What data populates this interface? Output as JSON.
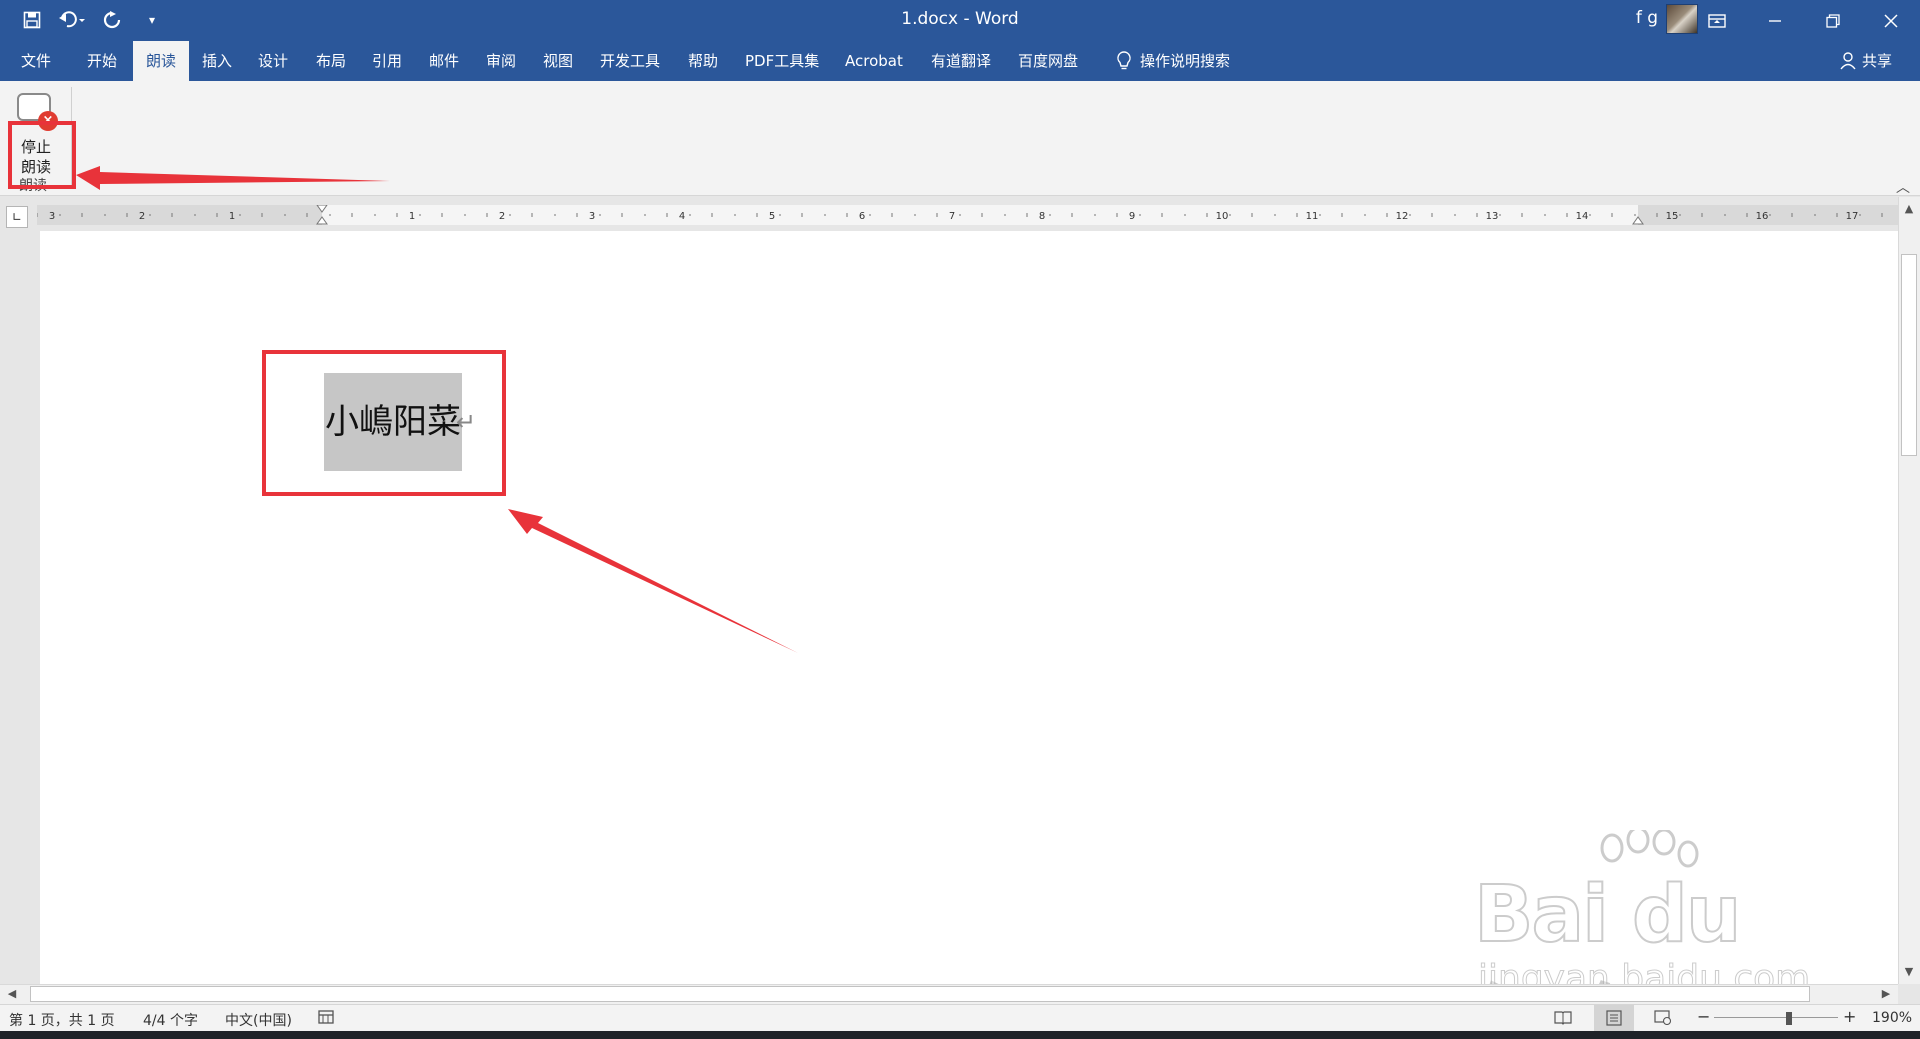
{
  "titlebar": {
    "title": "1.docx - Word",
    "user": "f g",
    "qat": [
      "save-icon",
      "undo-icon",
      "redo-icon",
      "customize-icon"
    ]
  },
  "tabs": [
    "文件",
    "开始",
    "朗读",
    "插入",
    "设计",
    "布局",
    "引用",
    "邮件",
    "审阅",
    "视图",
    "开发工具",
    "帮助",
    "PDF工具集",
    "Acrobat",
    "有道翻译",
    "百度网盘",
    "操作说明搜索"
  ],
  "active_tab": "朗读",
  "share_label": "共享",
  "ribbon": {
    "stop_line1": "停止",
    "stop_line2": "朗读",
    "group_label": "朗读"
  },
  "ruler": {
    "left_labels": [
      "3",
      "2",
      "1"
    ],
    "right_labels": [
      "1",
      "2",
      "3",
      "4",
      "5",
      "6",
      "7",
      "8",
      "9",
      "10",
      "11",
      "12",
      "13",
      "14",
      "15",
      "16",
      "17"
    ]
  },
  "document": {
    "text": "小嶋阳菜",
    "para_mark": "↵"
  },
  "status": {
    "page": "第 1 页，共 1 页",
    "words": "4/4 个字",
    "language": "中文(中国)",
    "zoom": "190%"
  },
  "watermark": {
    "logo": "Bai du 经验",
    "url": "jingyan.baidu.com"
  },
  "colors": {
    "brand": "#2b579a",
    "annotation": "#e8333a"
  }
}
